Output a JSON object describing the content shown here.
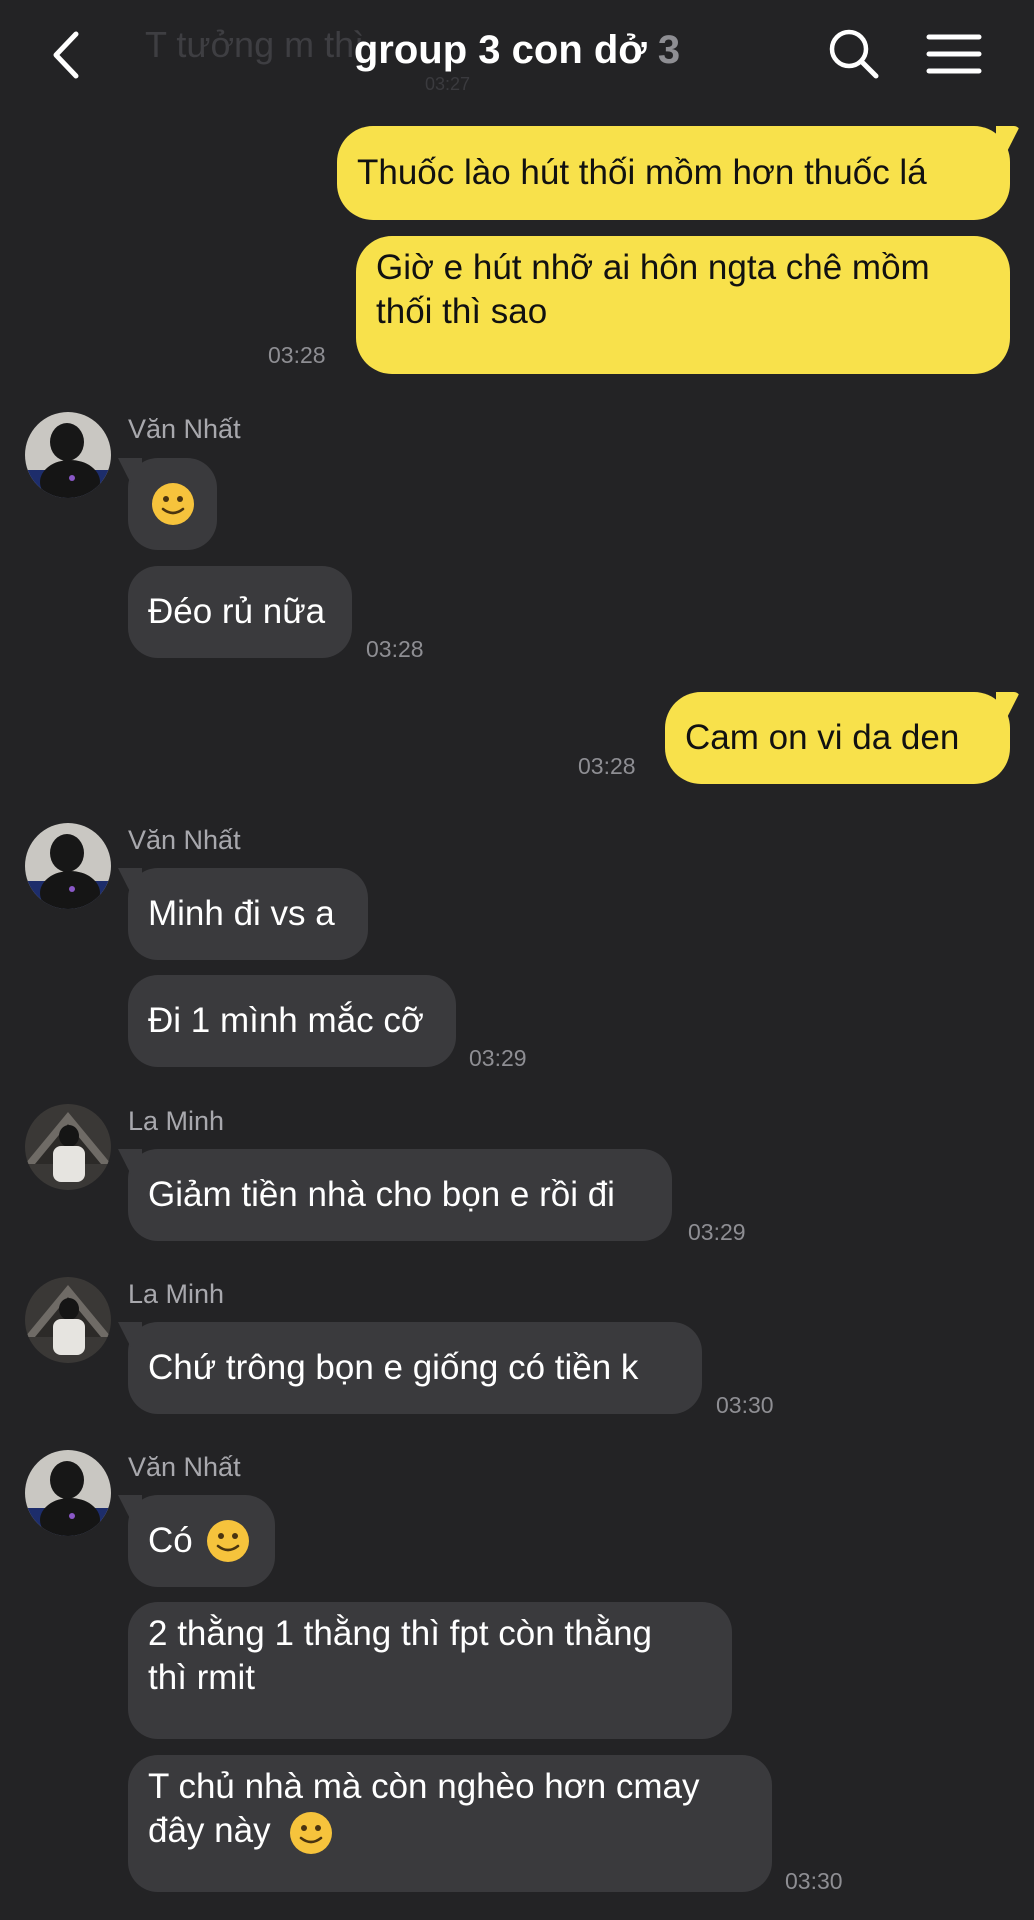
{
  "header": {
    "title": "group 3 con dở",
    "member_count": "3",
    "ghost_text": "T tưởng m thì",
    "ghost_time": "03:27",
    "back_icon": "chevron-left-icon",
    "search_icon": "search-icon",
    "menu_icon": "hamburger-menu-icon"
  },
  "colors": {
    "background": "#232325",
    "outgoing_bubble": "#f8e14b",
    "incoming_bubble": "#3a3a3d",
    "timestamp": "#8e8e93"
  },
  "messages": {
    "m1": {
      "text": "Thuốc lào hút thối mồm hơn thuốc lá",
      "direction": "outgoing"
    },
    "m2": {
      "line1": "Giờ e hút nhỡ ai hôn ngta chê mồm",
      "line2": "thối thì sao",
      "time": "03:28",
      "direction": "outgoing"
    },
    "g1": {
      "sender": "Văn Nhất",
      "emoji": "slightly-smiling-face-emoji",
      "text": "Đéo rủ nữa",
      "time": "03:28"
    },
    "m3": {
      "text": "Cam on vi da den",
      "time": "03:28",
      "direction": "outgoing"
    },
    "g2": {
      "sender": "Văn Nhất",
      "text1": "Minh đi vs a",
      "text2": "Đi 1 mình mắc cỡ",
      "time": "03:29"
    },
    "g3": {
      "sender": "La Minh",
      "text": "Giảm tiền nhà cho bọn e rồi đi",
      "time": "03:29"
    },
    "g4": {
      "sender": "La Minh",
      "text": "Chứ trông bọn e giống có tiền k",
      "time": "03:30"
    },
    "g5": {
      "sender": "Văn Nhất",
      "text1": "Có",
      "text2_line1": "2 thằng 1 thằng thì fpt còn thằng",
      "text2_line2": "thì rmit",
      "text3_line1": "T chủ nhà mà còn nghèo hơn cmay",
      "text3_line2": "đây này",
      "time": "03:30"
    }
  }
}
